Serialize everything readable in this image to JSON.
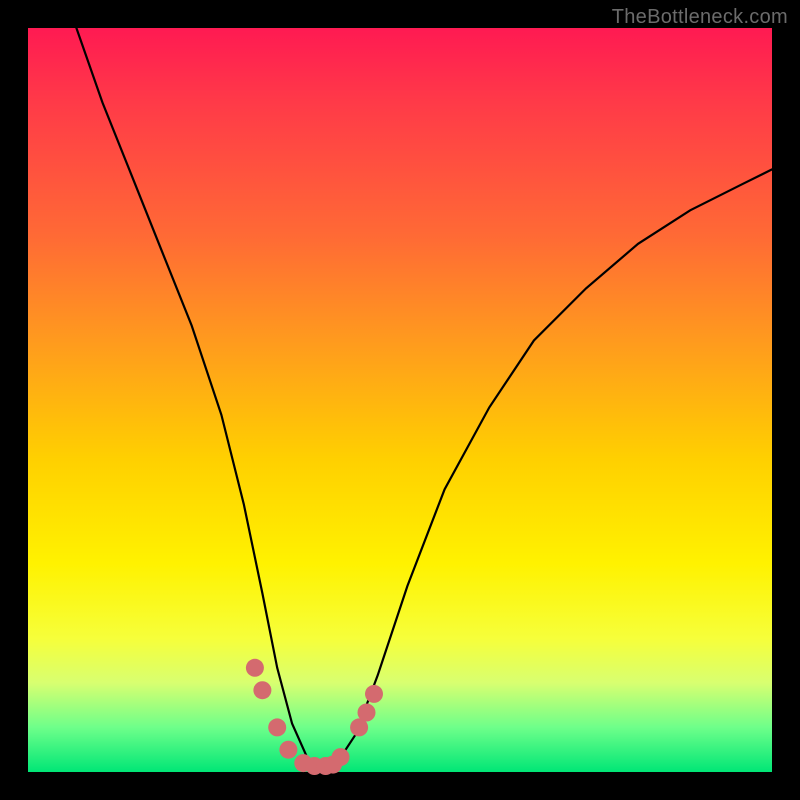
{
  "watermark": "TheBottleneck.com",
  "chart_data": {
    "type": "line",
    "title": "",
    "xlabel": "",
    "ylabel": "",
    "xlim": [
      0,
      100
    ],
    "ylim": [
      0,
      100
    ],
    "series": [
      {
        "name": "bottleneck-curve",
        "x": [
          6.5,
          10,
          14,
          18,
          22,
          26,
          29,
          31.5,
          33.5,
          35.5,
          37.5,
          39.5,
          41.5,
          44,
          47,
          51,
          56,
          62,
          68,
          75,
          82,
          89,
          96,
          100
        ],
        "values": [
          100,
          90,
          80,
          70,
          60,
          48,
          36,
          24,
          14,
          6.5,
          2.0,
          0.5,
          1.2,
          5,
          13,
          25,
          38,
          49,
          58,
          65,
          71,
          75.5,
          79,
          81
        ]
      }
    ],
    "markers": {
      "name": "highlight-points",
      "x": [
        30.5,
        31.5,
        33.5,
        35.0,
        37.0,
        38.5,
        40.0,
        41.0,
        42.0,
        44.5,
        45.5,
        46.5
      ],
      "values": [
        14.0,
        11.0,
        6.0,
        3.0,
        1.2,
        0.8,
        0.8,
        1.0,
        2.0,
        6.0,
        8.0,
        10.5
      ],
      "color": "#d46a6f",
      "radius_px": 9
    }
  }
}
